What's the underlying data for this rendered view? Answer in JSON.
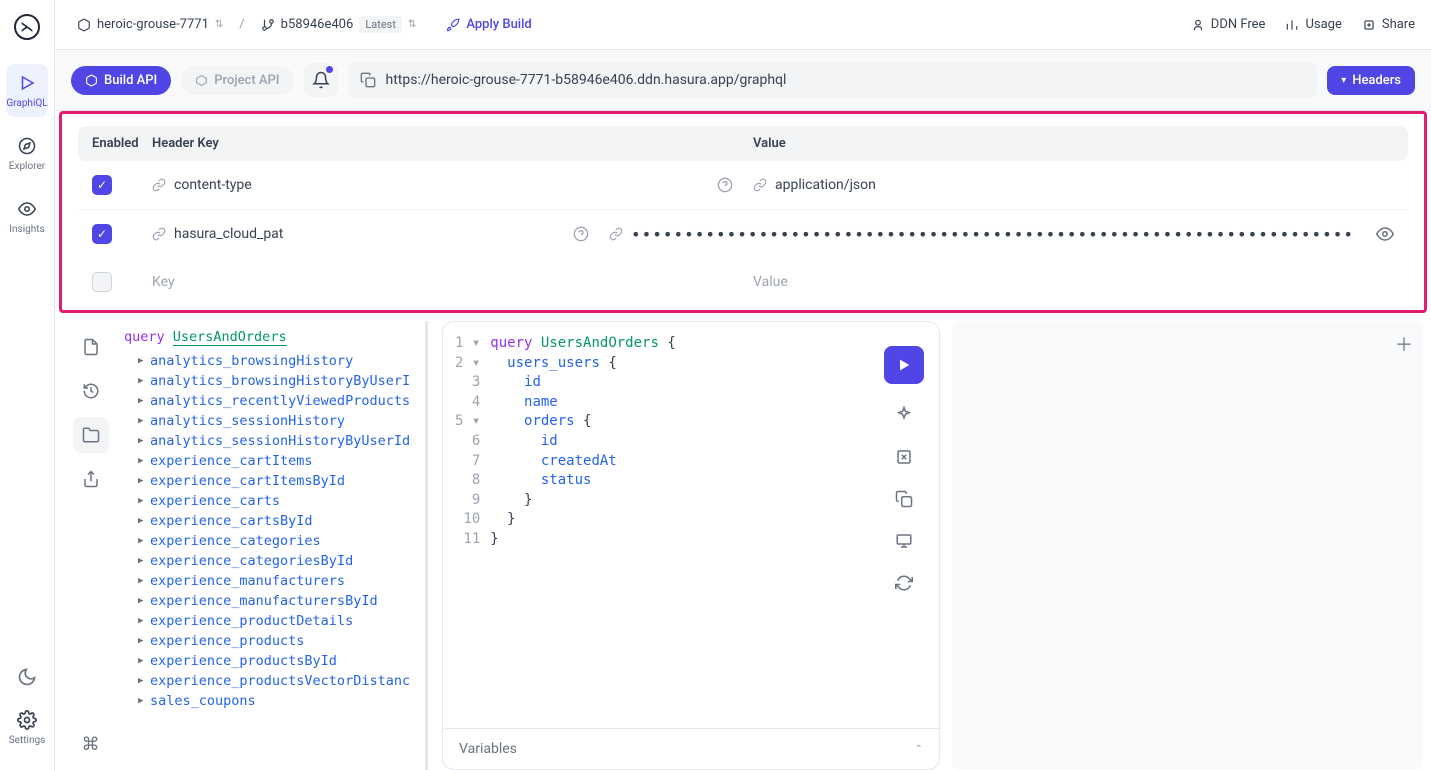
{
  "breadcrumb": {
    "project": "heroic-grouse-7771",
    "build": "b58946e406",
    "badge": "Latest",
    "apply": "Apply Build"
  },
  "top": {
    "ddn": "DDN Free",
    "usage": "Usage",
    "share": "Share"
  },
  "rail": {
    "graphiql": "GraphiQL",
    "explorer": "Explorer",
    "insights": "Insights",
    "settings": "Settings"
  },
  "action": {
    "build_api": "Build API",
    "project_api": "Project API",
    "url": "https://heroic-grouse-7771-b58946e406.ddn.hasura.app/graphql",
    "headers_btn": "Headers"
  },
  "headers": {
    "col_enabled": "Enabled",
    "col_key": "Header Key",
    "col_value": "Value",
    "rows": [
      {
        "key": "content-type",
        "value": "application/json",
        "masked": false
      },
      {
        "key": "hasura_cloud_pat",
        "value": "••••••••••••••••••••••••••••••••••••••••••••••••••••••••••••••••••••",
        "masked": true
      }
    ],
    "placeholder_key": "Key",
    "placeholder_value": "Value"
  },
  "tree": {
    "keyword": "query",
    "name": "UsersAndOrders",
    "items": [
      "analytics_browsingHistory",
      "analytics_browsingHistoryByUserI",
      "analytics_recentlyViewedProducts",
      "analytics_sessionHistory",
      "analytics_sessionHistoryByUserId",
      "experience_cartItems",
      "experience_cartItemsById",
      "experience_carts",
      "experience_cartsById",
      "experience_categories",
      "experience_categoriesById",
      "experience_manufacturers",
      "experience_manufacturersById",
      "experience_productDetails",
      "experience_products",
      "experience_productsById",
      "experience_productsVectorDistanc",
      "sales_coupons"
    ]
  },
  "editor": {
    "lines": [
      {
        "n": "1",
        "fold": "▾",
        "html": "<span class='kw2'>query</span> <span class='fn'>UsersAndOrders</span> <span class='br'>{</span>"
      },
      {
        "n": "2",
        "fold": "▾",
        "html": "  <span class='fld'>users_users</span> <span class='br'>{</span>"
      },
      {
        "n": "3",
        "fold": "",
        "html": "    <span class='fld'>id</span>"
      },
      {
        "n": "4",
        "fold": "",
        "html": "    <span class='fld'>name</span>"
      },
      {
        "n": "5",
        "fold": "▾",
        "html": "    <span class='fld'>orders</span> <span class='br'>{</span>"
      },
      {
        "n": "6",
        "fold": "",
        "html": "      <span class='fld'>id</span>"
      },
      {
        "n": "7",
        "fold": "",
        "html": "      <span class='fld'>createdAt</span>"
      },
      {
        "n": "8",
        "fold": "",
        "html": "      <span class='fld'>status</span>"
      },
      {
        "n": "9",
        "fold": "",
        "html": "    <span class='br'>}</span>"
      },
      {
        "n": "10",
        "fold": "",
        "html": "  <span class='br'>}</span>"
      },
      {
        "n": "11",
        "fold": "",
        "html": "<span class='br'>}</span>"
      }
    ],
    "variables": "Variables"
  }
}
